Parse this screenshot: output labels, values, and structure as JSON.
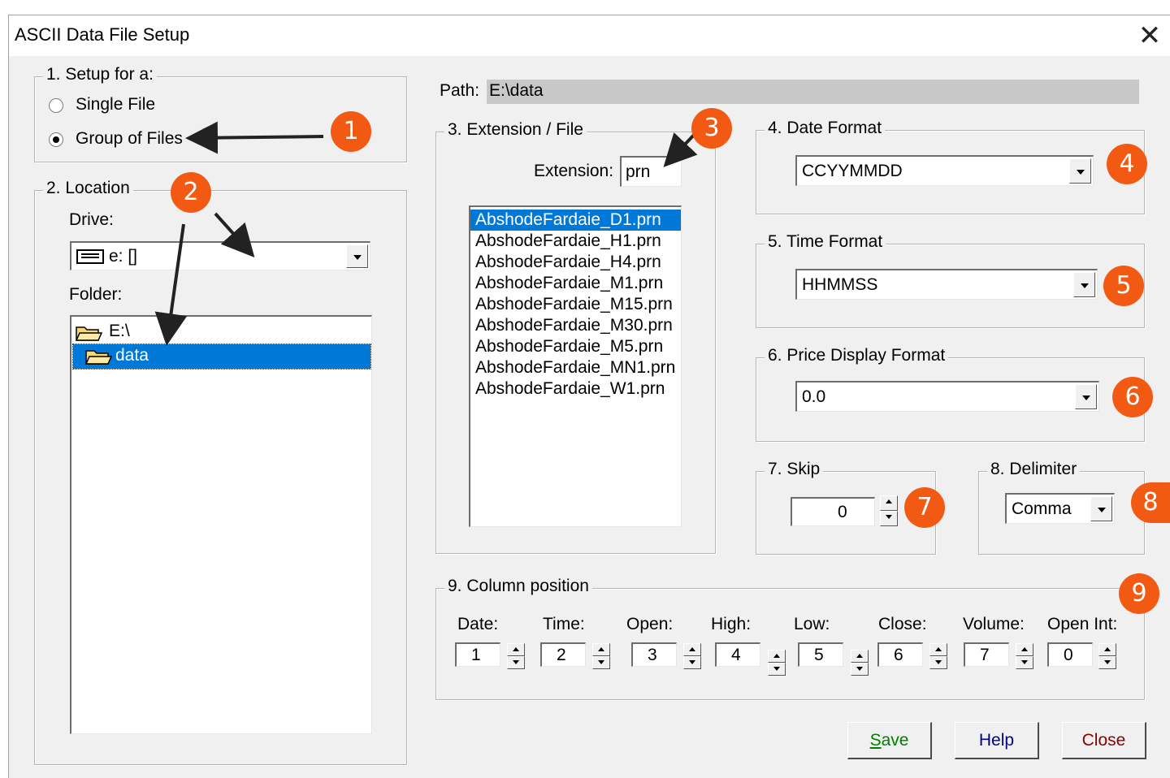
{
  "window": {
    "title": "ASCII Data File Setup",
    "close_glyph": "✕"
  },
  "setup": {
    "label": "1. Setup for a:",
    "options": [
      {
        "label": "Single File",
        "selected": false
      },
      {
        "label": "Group of Files",
        "selected": true
      }
    ]
  },
  "location": {
    "label": "2. Location",
    "drive_label": "Drive:",
    "drive_value": "e: []",
    "folder_label": "Folder:",
    "folders": [
      {
        "name": "E:\\",
        "selected": false
      },
      {
        "name": "data",
        "selected": true
      }
    ]
  },
  "path": {
    "label": "Path:",
    "value": "E:\\data"
  },
  "extension": {
    "label": "3. Extension / File",
    "ext_label": "Extension:",
    "ext_value": "prn",
    "files": [
      "AbshodeFardaie_D1.prn",
      "AbshodeFardaie_H1.prn",
      "AbshodeFardaie_H4.prn",
      "AbshodeFardaie_M1.prn",
      "AbshodeFardaie_M15.prn",
      "AbshodeFardaie_M30.prn",
      "AbshodeFardaie_M5.prn",
      "AbshodeFardaie_MN1.prn",
      "AbshodeFardaie_W1.prn"
    ],
    "selected_index": 0
  },
  "date_format": {
    "label": "4. Date Format",
    "value": "CCYYMMDD"
  },
  "time_format": {
    "label": "5. Time Format",
    "value": "HHMMSS"
  },
  "price_format": {
    "label": "6. Price Display Format",
    "value": "0.0"
  },
  "skip": {
    "label": "7. Skip",
    "value": "0"
  },
  "delimiter": {
    "label": "8. Delimiter",
    "value": "Comma"
  },
  "columns": {
    "label": "9. Column position",
    "items": [
      {
        "label": "Date:",
        "value": "1"
      },
      {
        "label": "Time:",
        "value": "2"
      },
      {
        "label": "Open:",
        "value": "3"
      },
      {
        "label": "High:",
        "value": "4"
      },
      {
        "label": "Low:",
        "value": "5"
      },
      {
        "label": "Close:",
        "value": "6"
      },
      {
        "label": "Volume:",
        "value": "7"
      },
      {
        "label": "Open Int:",
        "value": "0"
      }
    ]
  },
  "buttons": {
    "save": {
      "label": "Save",
      "color": "#008000"
    },
    "help": {
      "label": "Help",
      "color": "#00008b"
    },
    "close": {
      "label": "Close",
      "color": "#8b0000"
    }
  },
  "annotations": [
    "1",
    "2",
    "3",
    "4",
    "5",
    "6",
    "7",
    "8",
    "9"
  ],
  "colors": {
    "badge": "#f25a13",
    "selection": "#0078d7"
  }
}
